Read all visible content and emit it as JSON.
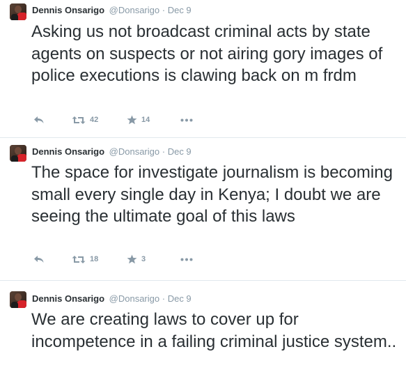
{
  "colors": {
    "text": "#292f33",
    "muted": "#8899a6",
    "divider": "#e1e8ed",
    "avatar_accent": "#d6232a"
  },
  "icons": {
    "reply": "reply-icon",
    "retweet": "retweet-icon",
    "favorite": "star-icon",
    "more": "more-dots-icon"
  },
  "tweets": [
    {
      "name": "Dennis Onsarigo",
      "handle": "@Donsarigo",
      "separator": "·",
      "date": "Dec 9",
      "text": "Asking us not broadcast criminal acts by state agents on suspects or not airing gory images of police executions is clawing back on m frdm",
      "retweets": "42",
      "favorites": "14"
    },
    {
      "name": "Dennis Onsarigo",
      "handle": "@Donsarigo",
      "separator": "·",
      "date": "Dec 9",
      "text": "The space for investigate journalism is becoming small every single day in Kenya; I doubt we are seeing the ultimate goal of this laws",
      "retweets": "18",
      "favorites": "3"
    },
    {
      "name": "Dennis Onsarigo",
      "handle": "@Donsarigo",
      "separator": "·",
      "date": "Dec 9",
      "text": "We are creating laws to cover up for incompetence in a failing criminal justice system.."
    }
  ]
}
